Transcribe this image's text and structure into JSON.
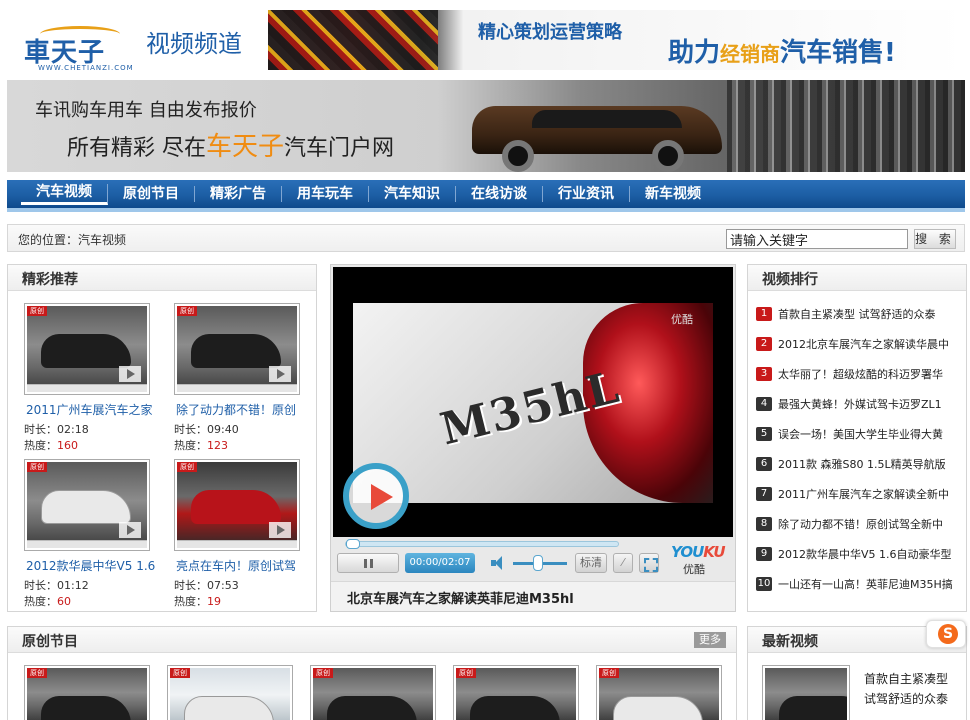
{
  "header": {
    "logo_text": "車天子",
    "logo_url": "WWW.CHETIANZI.COM",
    "channel": "视频频道",
    "banner_line1": "精心策划运营策略",
    "banner_line2_a": "助力",
    "banner_line2_b": "经销商",
    "banner_line2_c": "汽车销售!"
  },
  "hero": {
    "line1": "车讯购车用车  自由发布报价",
    "line2_a": "所有精彩  尽在",
    "line2_brand": "车天子",
    "line2_b": "汽车门户网"
  },
  "nav": {
    "items": [
      "汽车视频",
      "原创节目",
      "精彩广告",
      "用车玩车",
      "汽车知识",
      "在线访谈",
      "行业资讯",
      "新车视频"
    ]
  },
  "breadcrumb": {
    "text": "您的位置：汽车视频"
  },
  "search": {
    "value": "请输入关键字",
    "button": "搜 索"
  },
  "recommend": {
    "title": "精彩推荐",
    "items": [
      {
        "title": "2011广州车展汽车之家",
        "duration": "时长：02:18",
        "heat_label": "热度：",
        "heat": "160"
      },
      {
        "title": "除了动力都不错！原创",
        "duration": "时长：09:40",
        "heat_label": "热度：",
        "heat": "123"
      },
      {
        "title": "2012款华晨中华V5 1.6",
        "duration": "时长：01:12",
        "heat_label": "热度：",
        "heat": "60"
      },
      {
        "title": "亮点在车内！原创试驾",
        "duration": "时长：07:53",
        "heat_label": "热度：",
        "heat": "19"
      }
    ]
  },
  "player": {
    "badge": "M35hL",
    "watermark": "优酷",
    "time": "00:00/02:07",
    "progress": 0.017,
    "quality": "标清",
    "brand_a": "YOU",
    "brand_b": "KU",
    "brand_cn": "优酷",
    "caption": "北京车展汽车之家解读英菲尼迪M35hl"
  },
  "ranking": {
    "title": "视频排行",
    "items": [
      {
        "n": "1",
        "text": "首款自主紧凑型 试驾舒适的众泰"
      },
      {
        "n": "2",
        "text": "2012北京车展汽车之家解读华晨中"
      },
      {
        "n": "3",
        "text": "太华丽了！超级炫酷的科迈罗署华"
      },
      {
        "n": "4",
        "text": "最强大黄蜂！外媒试驾卡迈罗ZL1"
      },
      {
        "n": "5",
        "text": "误会一场！美国大学生毕业得大黄"
      },
      {
        "n": "6",
        "text": "2011款 森雅S80 1.5L精英导航版"
      },
      {
        "n": "7",
        "text": "2011广州车展汽车之家解读全新中"
      },
      {
        "n": "8",
        "text": "除了动力都不错！原创试驾全新中"
      },
      {
        "n": "9",
        "text": "2012款华晨中华V5 1.6自动豪华型"
      },
      {
        "n": "10",
        "text": "一山还有一山高！英菲尼迪M35H搞"
      }
    ]
  },
  "original": {
    "title": "原创节目",
    "more": "更多"
  },
  "latest": {
    "title": "最新视频",
    "item_text": "首款自主紧凑型 试驾舒适的众泰"
  },
  "colors": {
    "accent": "#1f5fa8",
    "brand_orange": "#f08c12",
    "rank_red": "#c81a1a",
    "nav_blue": "#1c5ea4"
  }
}
